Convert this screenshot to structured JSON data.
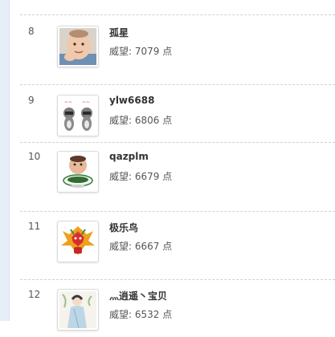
{
  "ranking": {
    "items": [
      {
        "rank": "8",
        "name": "孤星",
        "score_label": "威望:",
        "score_value": "7079",
        "unit": "点",
        "avatar_icon": "baby-photo-avatar-icon"
      },
      {
        "rank": "9",
        "name": "ylw6688",
        "score_label": "威望:",
        "score_value": "6806",
        "unit": "点",
        "avatar_icon": "raccoon-cartoon-avatar-icon"
      },
      {
        "rank": "10",
        "name": "qazplm",
        "score_label": "威望:",
        "score_value": "6679",
        "unit": "点",
        "avatar_icon": "baby-tea-cup-avatar-icon"
      },
      {
        "rank": "11",
        "name": "极乐鸟",
        "score_label": "威望:",
        "score_value": "6667",
        "unit": "点",
        "avatar_icon": "bird-mascot-avatar-icon"
      },
      {
        "rank": "12",
        "name": "灬逍遥丶宝贝",
        "score_label": "威望:",
        "score_value": "6532",
        "unit": "点",
        "avatar_icon": "girl-painting-avatar-icon"
      }
    ]
  }
}
